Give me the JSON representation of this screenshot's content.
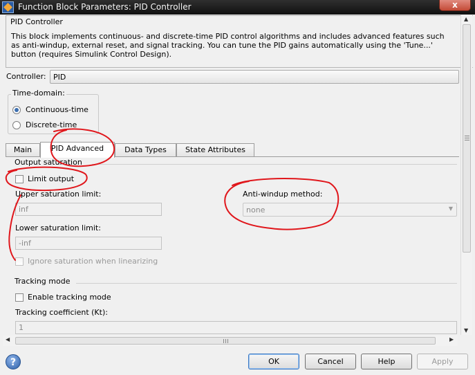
{
  "window": {
    "title": "Function Block Parameters: PID Controller",
    "close_glyph": "x"
  },
  "description": {
    "heading": "PID Controller",
    "text": "This block implements continuous- and discrete-time PID control algorithms and includes advanced features such\nas anti-windup, external reset, and signal tracking. You can tune the PID gains automatically using the 'Tune...'\nbutton (requires Simulink Control Design)."
  },
  "controller": {
    "label": "Controller:",
    "value": "PID"
  },
  "time_domain": {
    "legend": "Time-domain:",
    "options": [
      "Continuous-time",
      "Discrete-time"
    ],
    "selected": "Continuous-time"
  },
  "tabs": [
    {
      "label": "Main"
    },
    {
      "label": "PID Advanced"
    },
    {
      "label": "Data Types"
    },
    {
      "label": "State Attributes"
    }
  ],
  "active_tab": "PID Advanced",
  "output_saturation": {
    "legend": "Output saturation",
    "limit_output_label": "Limit output",
    "limit_output_checked": false,
    "upper_label": "Upper saturation limit:",
    "upper_value": "inf",
    "lower_label": "Lower saturation limit:",
    "lower_value": "-inf",
    "antiwindup_label": "Anti-windup method:",
    "antiwindup_value": "none",
    "ignore_label": "Ignore saturation when linearizing"
  },
  "tracking": {
    "legend": "Tracking mode",
    "enable_label": "Enable tracking mode",
    "enable_checked": false,
    "coef_label": "Tracking coefficient (Kt):",
    "coef_value": "1"
  },
  "buttons": {
    "help_glyph": "?",
    "ok": "OK",
    "cancel": "Cancel",
    "help": "Help",
    "apply": "Apply"
  },
  "colors": {
    "annotation": "#e0161b",
    "titlebar": "#1a1a1a",
    "default_button_border": "#3b78c3"
  }
}
